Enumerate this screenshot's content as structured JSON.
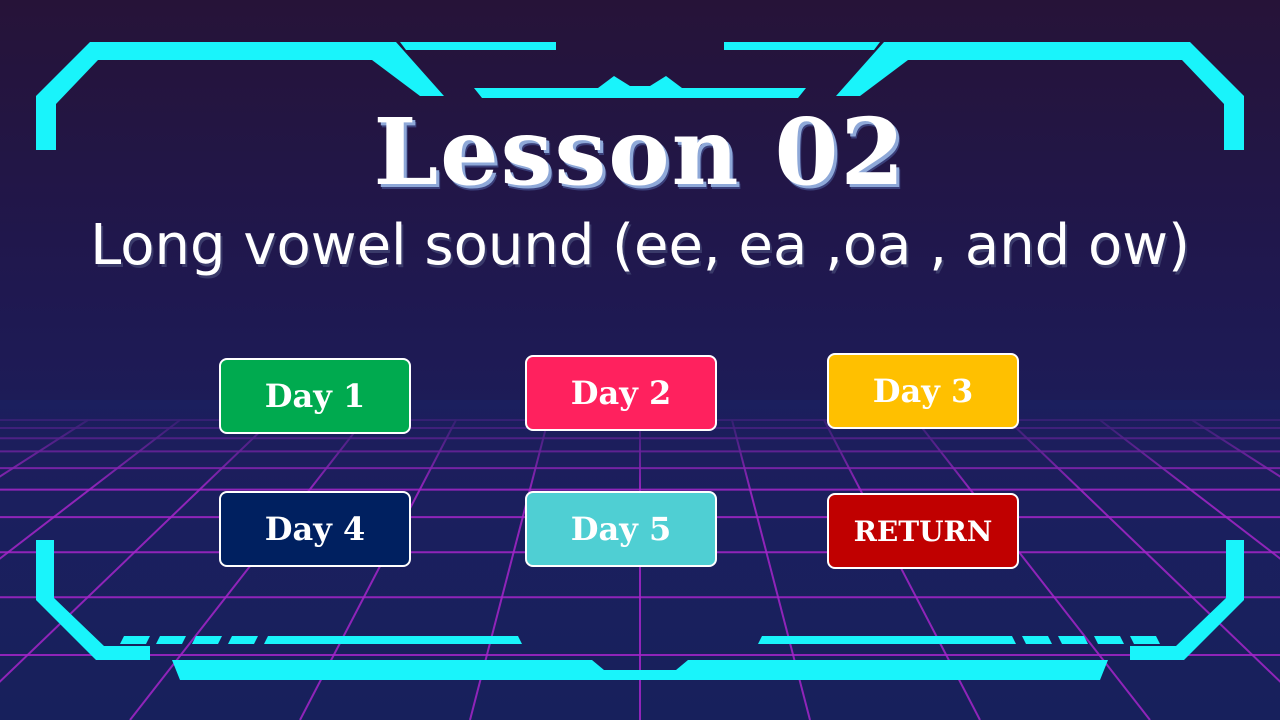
{
  "title": "Lesson 02",
  "subtitle": "Long vowel sound (ee, ea ,oa , and ow)",
  "buttons": [
    {
      "label": "Day 1",
      "color": "#00aa4f"
    },
    {
      "label": "Day 2",
      "color": "#ff215e"
    },
    {
      "label": "Day 3",
      "color": "#ffc000"
    },
    {
      "label": "Day 4",
      "color": "#002060"
    },
    {
      "label": "Day 5",
      "color": "#4fcfd3"
    },
    {
      "label": "RETURN",
      "color": "#c00000"
    }
  ],
  "colors": {
    "frame_accent": "#19f4fb",
    "grid_lines": "#a526c9",
    "background_top": "#261338",
    "background_bottom": "#17205c"
  }
}
